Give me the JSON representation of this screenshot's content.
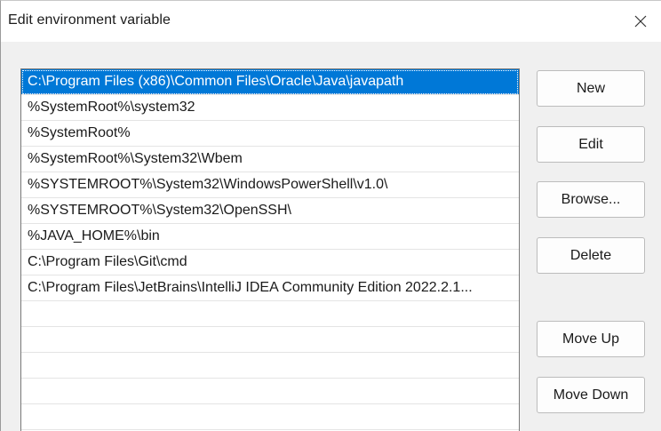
{
  "window": {
    "title": "Edit environment variable"
  },
  "list": {
    "items": [
      "C:\\Program Files (x86)\\Common Files\\Oracle\\Java\\javapath",
      "%SystemRoot%\\system32",
      "%SystemRoot%",
      "%SystemRoot%\\System32\\Wbem",
      "%SYSTEMROOT%\\System32\\WindowsPowerShell\\v1.0\\",
      "%SYSTEMROOT%\\System32\\OpenSSH\\",
      "%JAVA_HOME%\\bin",
      "C:\\Program Files\\Git\\cmd",
      "C:\\Program Files\\JetBrains\\IntelliJ IDEA Community Edition 2022.2.1..."
    ],
    "selected_index": 0
  },
  "buttons": {
    "new": "New",
    "edit": "Edit",
    "browse": "Browse...",
    "delete": "Delete",
    "move_up": "Move Up",
    "move_down": "Move Down"
  },
  "icons": {
    "close": "close-icon"
  },
  "colors": {
    "selection": "#0078d7",
    "background": "#f0f0f0"
  }
}
